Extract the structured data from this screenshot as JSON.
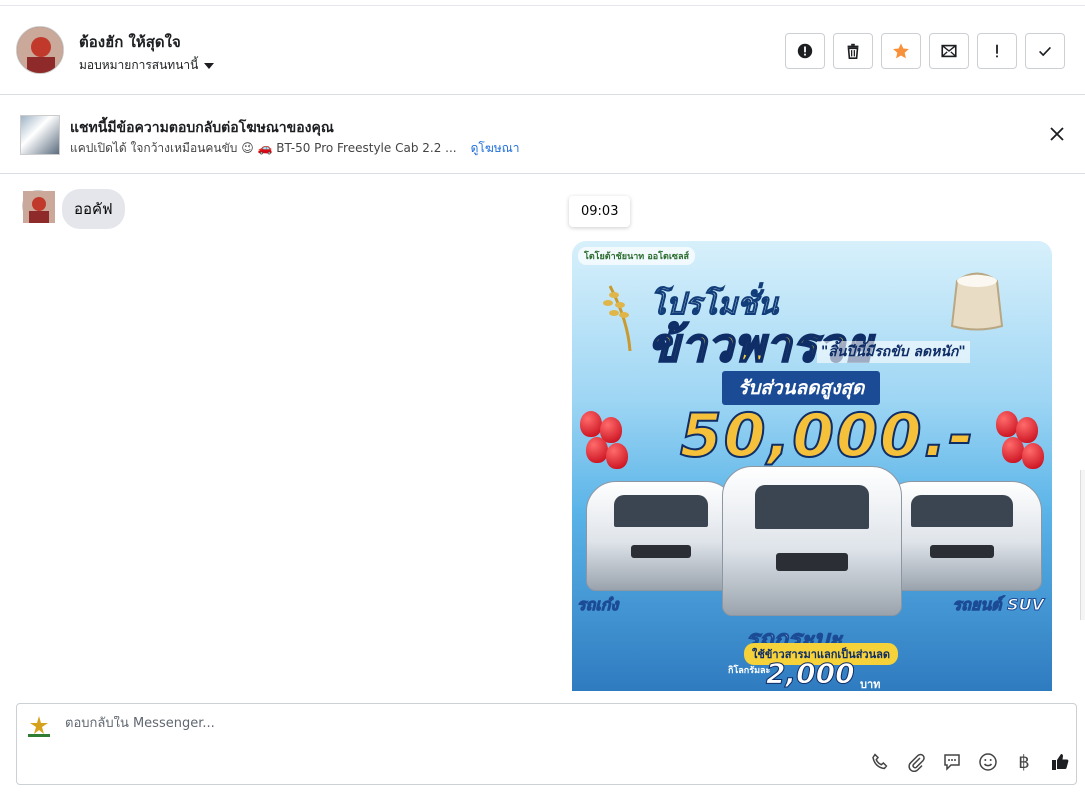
{
  "header": {
    "contact_name": "ต้องฮัก ให้สุดใจ",
    "assign_label": "มอบหมายการสนทนานี้",
    "actions": [
      {
        "name": "report-spam-button",
        "icon": "alert-circle-icon"
      },
      {
        "name": "delete-button",
        "icon": "trash-icon"
      },
      {
        "name": "star-button",
        "icon": "star-icon"
      },
      {
        "name": "mark-unread-button",
        "icon": "envelope-icon"
      },
      {
        "name": "follow-up-button",
        "icon": "exclamation-icon"
      },
      {
        "name": "mark-done-button",
        "icon": "check-icon"
      }
    ],
    "star_color": "#f7923b"
  },
  "ad_context": {
    "title": "แชทนี้มีข้อความตอบกลับต่อโฆษณาของคุณ",
    "subtitle": "แคปเปิดได้ ใจกว้างเหมือนคนขับ 😉 🚗 BT-50 Pro Freestyle Cab 2.2 ...",
    "link_label": "ดูโฆษณา",
    "link_color": "#216fdb"
  },
  "thread": {
    "incoming_message": "ออคัฟ",
    "timestamp": "09:03",
    "promo_image": {
      "brand": "โตโยต้าชัยนาท ออโตเซลส์",
      "headline_line1": "โปรโมชั่น",
      "headline_line2": "ข้าวพารวย",
      "tagline": "\"สิ้นปีนี้มีรถขับ ลดหนัก\"",
      "discount_label": "รับส่วนลดสูงสุด",
      "amount": "50,000.-",
      "label_left": "รถเก๋ง",
      "label_right": "รถยนต์ SUV",
      "label_center": "รถกระบะ",
      "pill_text": "ใช้ข้าวสารมาแลกเป็นส่วนลด",
      "per_kg": "กิโลกรัมละ",
      "price": "2,000",
      "baht": "บาท"
    }
  },
  "composer": {
    "placeholder": "ตอบกลับใน Messenger...",
    "tools": [
      {
        "name": "call-button",
        "icon": "phone-icon"
      },
      {
        "name": "attach-button",
        "icon": "paperclip-icon"
      },
      {
        "name": "saved-replies-button",
        "icon": "chat-bubble-icon"
      },
      {
        "name": "emoji-button",
        "icon": "smiley-icon"
      },
      {
        "name": "payment-button",
        "icon": "baht-icon",
        "glyph": "฿"
      },
      {
        "name": "like-button",
        "icon": "thumbs-up-icon"
      }
    ]
  }
}
